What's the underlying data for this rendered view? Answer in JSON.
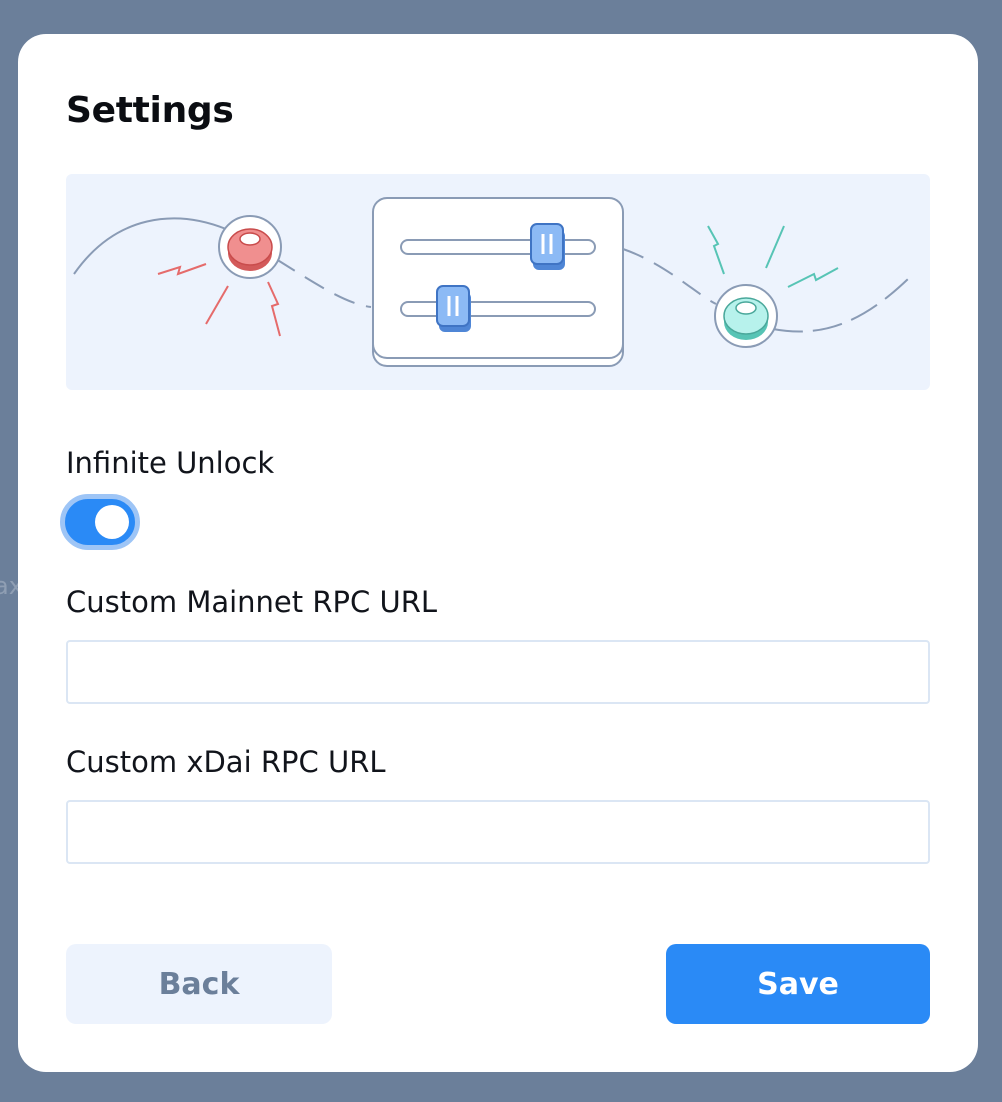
{
  "modal": {
    "title": "Settings"
  },
  "backdrop": {
    "partial_text": "ax"
  },
  "illustration": {
    "name": "settings-sliders-illustration"
  },
  "settings": {
    "infinite_unlock": {
      "label": "Infinite Unlock",
      "enabled": true
    },
    "mainnet_rpc": {
      "label": "Custom Mainnet RPC URL",
      "value": "",
      "placeholder": ""
    },
    "xdai_rpc": {
      "label": "Custom xDai RPC URL",
      "value": "",
      "placeholder": ""
    }
  },
  "actions": {
    "back_label": "Back",
    "save_label": "Save"
  },
  "colors": {
    "accent": "#2a8af6",
    "backdrop": "#6b7f9a",
    "illustration_bg": "#edf3fd",
    "back_button_bg": "#edf3fd",
    "back_button_text": "#6b7f9a"
  }
}
